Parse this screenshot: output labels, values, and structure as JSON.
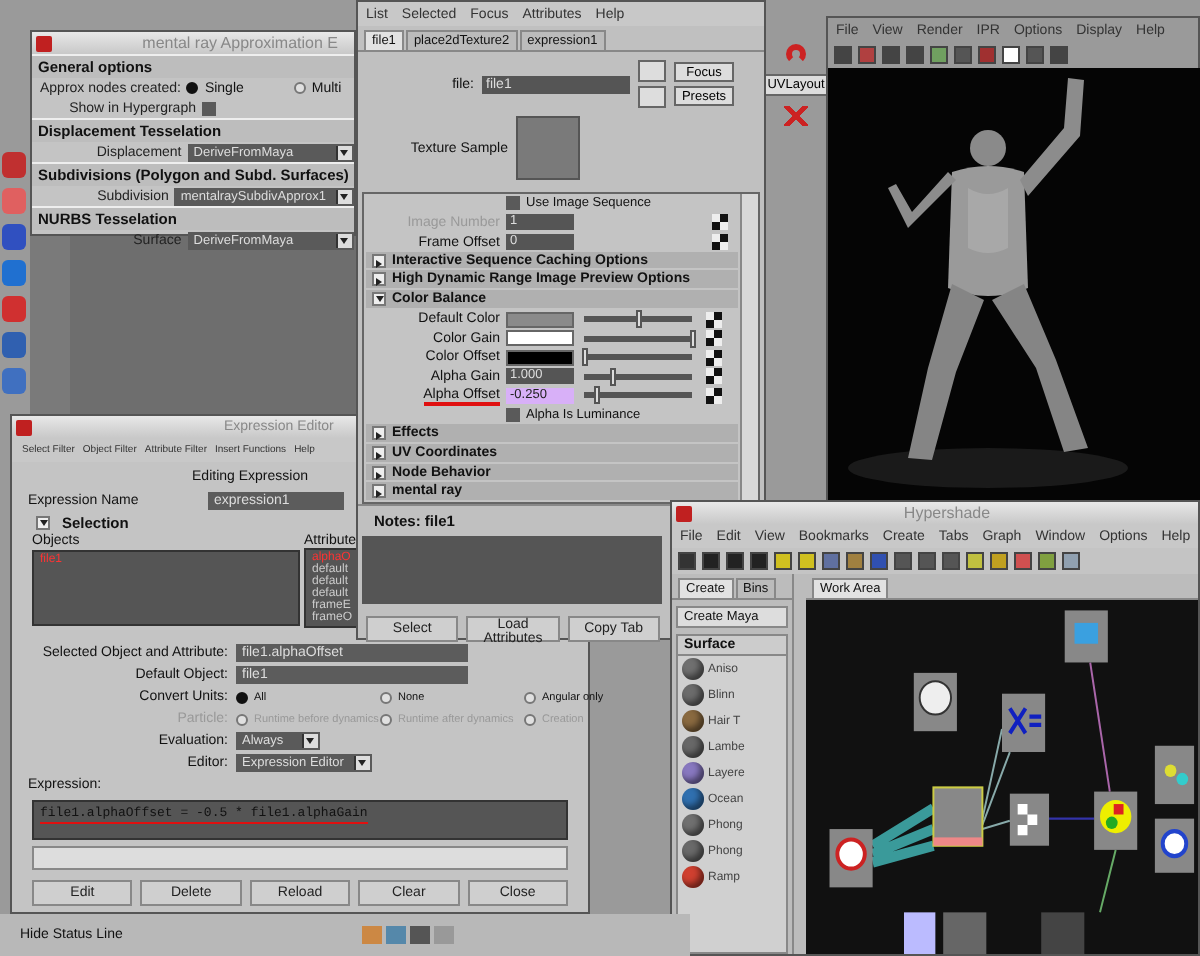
{
  "approx_window": {
    "title": "mental ray Approximation E",
    "sections": [
      {
        "title": "General options",
        "rows": [
          {
            "kind": "radio",
            "label": "Approx nodes created:",
            "options": [
              {
                "label": "Single",
                "selected": true
              },
              {
                "label": "Multi",
                "selected": false
              }
            ]
          },
          {
            "kind": "checkbox",
            "label": "Show in Hypergraph",
            "checked": false
          }
        ]
      },
      {
        "title": "Displacement Tesselation",
        "rows": [
          {
            "kind": "dropdown",
            "label": "Displacement",
            "value": "DeriveFromMaya"
          }
        ]
      },
      {
        "title": "Subdivisions (Polygon and Subd. Surfaces)",
        "rows": [
          {
            "kind": "dropdown",
            "label": "Subdivision",
            "value": "mentalraySubdivApprox1"
          }
        ]
      },
      {
        "title": "NURBS Tesselation",
        "rows": [
          {
            "kind": "dropdown",
            "label": "Surface",
            "value": "DeriveFromMaya"
          }
        ]
      }
    ]
  },
  "attribute_editor": {
    "menu": [
      "List",
      "Selected",
      "Focus",
      "Attributes",
      "Help"
    ],
    "tabs": [
      {
        "label": "file1",
        "selected": true
      },
      {
        "label": "place2dTexture2",
        "selected": false
      },
      {
        "label": "expression1",
        "selected": false
      }
    ],
    "node_label": "file:",
    "node_name": "file1",
    "buttons": [
      "Focus",
      "Presets"
    ],
    "texture_sample_label": "Texture Sample",
    "use_image_sequence": {
      "label": "Use Image Sequence",
      "checked": false
    },
    "fields": [
      {
        "label": "Image Number",
        "value": "1",
        "disabled": true
      },
      {
        "label": "Frame Offset",
        "value": "0",
        "disabled": false
      }
    ],
    "sections": [
      {
        "title": "Interactive Sequence Caching Options",
        "expanded": false
      },
      {
        "title": "High Dynamic Range Image Preview Options",
        "expanded": false
      },
      {
        "title": "Color Balance",
        "expanded": true,
        "rows": [
          {
            "kind": "color",
            "label": "Default Color",
            "color": "#8a8a8a",
            "level": 0.5
          },
          {
            "kind": "color",
            "label": "Color Gain",
            "color": "#ffffff",
            "level": 1
          },
          {
            "kind": "color",
            "label": "Color Offset",
            "color": "#000000",
            "level": 0
          },
          {
            "kind": "number",
            "label": "Alpha Gain",
            "value": "1.000",
            "level": 0.25,
            "highlighted": false,
            "underlined": false
          },
          {
            "kind": "number",
            "label": "Alpha Offset",
            "value": "-0.250",
            "level": 0.12,
            "highlighted": true,
            "underlined": true
          }
        ],
        "alpha_is_luminance": {
          "label": "Alpha Is Luminance",
          "checked": false
        }
      },
      {
        "title": "Effects",
        "expanded": false
      },
      {
        "title": "UV Coordinates",
        "expanded": false
      },
      {
        "title": "Node Behavior",
        "expanded": false
      },
      {
        "title": "mental ray",
        "expanded": false
      }
    ],
    "notes": "Notes:  file1",
    "bottom_buttons": [
      "Select",
      "Load Attributes",
      "Copy Tab"
    ]
  },
  "render_view": {
    "shelf_button": "UVLayout",
    "menu": [
      "File",
      "View",
      "Render",
      "IPR",
      "Options",
      "Display",
      "Help"
    ]
  },
  "expression_editor": {
    "title": "Expression Editor",
    "menu": [
      "Select Filter",
      "Object Filter",
      "Attribute Filter",
      "Insert Functions",
      "Help"
    ],
    "mode": "Editing Expression",
    "name_label": "Expression Name",
    "name_value": "expression1",
    "selection": {
      "title": "Selection",
      "expanded": true
    },
    "objects_label": "Objects",
    "objects": [
      {
        "label": "file1",
        "selected": true
      }
    ],
    "attributes_label": "Attribute",
    "attributes": [
      {
        "label": "alphaO",
        "selected": true
      },
      {
        "label": "default",
        "selected": false
      },
      {
        "label": "default",
        "selected": false
      },
      {
        "label": "default",
        "selected": false
      },
      {
        "label": "frameE",
        "selected": false
      },
      {
        "label": "frameO",
        "selected": false
      }
    ],
    "selected_label": "Selected Object and Attribute:",
    "selected_value": "file1.alphaOffset",
    "default_object_label": "Default Object:",
    "default_object": "file1",
    "convert_units": {
      "label": "Convert Units:",
      "options": [
        {
          "label": "All",
          "selected": true
        },
        {
          "label": "None",
          "selected": false
        },
        {
          "label": "Angular only",
          "selected": false
        }
      ]
    },
    "particle": {
      "label": "Particle:",
      "disabled": true,
      "options": [
        {
          "label": "Runtime before dynamics",
          "selected": false
        },
        {
          "label": "Runtime after dynamics",
          "selected": false
        },
        {
          "label": "Creation",
          "selected": false
        }
      ]
    },
    "evaluation": {
      "label": "Evaluation:",
      "value": "Always"
    },
    "editor": {
      "label": "Editor:",
      "value": "Expression Editor"
    },
    "expression_label": "Expression:",
    "expression": "file1.alphaOffset = -0.5 * file1.alphaGain",
    "expression_underlined": true,
    "buttons": [
      "Edit",
      "Delete",
      "Reload",
      "Clear",
      "Close"
    ]
  },
  "hypershade": {
    "title": "Hypershade",
    "menu": [
      "File",
      "Edit",
      "View",
      "Bookmarks",
      "Create",
      "Tabs",
      "Graph",
      "Window",
      "Options",
      "Help"
    ],
    "left_tabs": [
      {
        "label": "Create",
        "selected": true
      },
      {
        "label": "Bins",
        "selected": false
      }
    ],
    "create_menu": "Create Maya",
    "category": "Surface",
    "shaders": [
      {
        "label": "Aniso",
        "color": "#707070"
      },
      {
        "label": "Blinn",
        "color": "#6c6c6c"
      },
      {
        "label": "Hair T",
        "color": "#8a6a40"
      },
      {
        "label": "Lambe",
        "color": "#686868"
      },
      {
        "label": "Layere",
        "color": "#8878c0"
      },
      {
        "label": "Ocean",
        "color": "#3070b0"
      },
      {
        "label": "Phong",
        "color": "#707070"
      },
      {
        "label": "Phong",
        "color": "#6a6a6a"
      },
      {
        "label": "Ramp",
        "color": "#d04030"
      }
    ],
    "work_tabs": [
      {
        "label": "Work Area",
        "selected": true
      }
    ]
  },
  "status_line": "Hide Status Line"
}
